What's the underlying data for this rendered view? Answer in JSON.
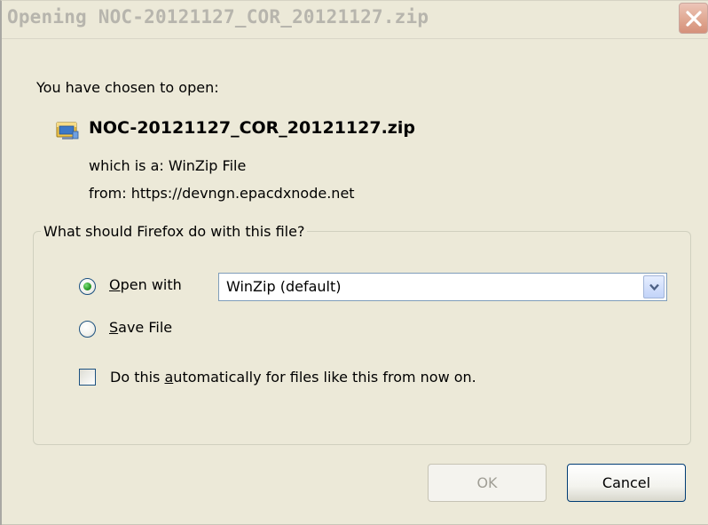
{
  "window": {
    "title": "Opening NOC-20121127_COR_20121127.zip"
  },
  "body": {
    "intro": "You have chosen to open:",
    "file_icon": "zip-archive-icon",
    "filename": "NOC-20121127_COR_20121127.zip",
    "type_row": "which is a:  WinZip File",
    "from_row": "from:  https://devngn.epacdxnode.net"
  },
  "group": {
    "legend": "What should Firefox do with this file?",
    "open_with": {
      "label_mnemonic": "O",
      "label_rest": "pen with",
      "selected": true
    },
    "app_select": {
      "value": "WinZip (default)"
    },
    "save_file": {
      "label_mnemonic": "S",
      "label_rest": "ave File",
      "selected": false
    },
    "auto_checkbox": {
      "label_before": "Do this ",
      "label_mnemonic": "a",
      "label_after": "utomatically for files like this from now on.",
      "checked": false
    }
  },
  "buttons": {
    "ok_label": "OK",
    "cancel_label": "Cancel"
  },
  "colors": {
    "dialog_bg": "#ece9d8",
    "close_button": "#e0a892",
    "radio_dot": "#2a9a27",
    "focus_border": "#003c74"
  }
}
